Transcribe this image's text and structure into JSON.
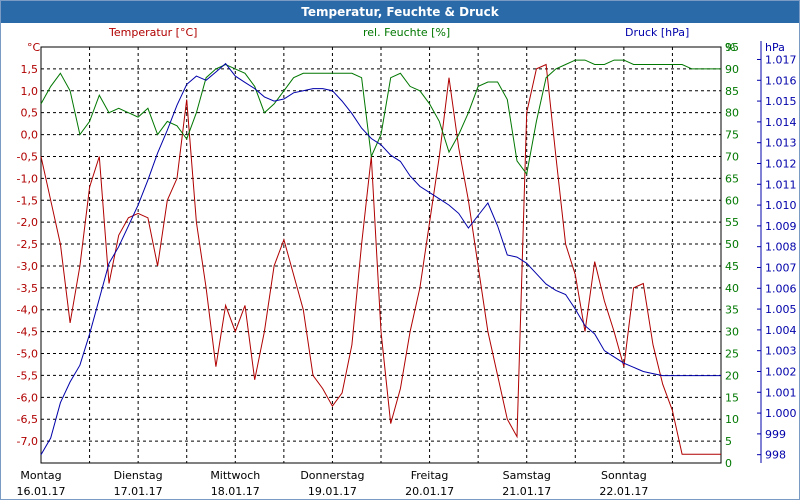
{
  "title": "Temperatur, Feuchte & Druck",
  "headers": {
    "temp": "Temperatur [°C]",
    "hum": "rel. Feuchte [%]",
    "press": "Druck [hPa]"
  },
  "colors": {
    "temp": "#b00000",
    "hum": "#007700",
    "press": "#0000aa",
    "grid": "#000000",
    "title_bg": "#2a6aa8"
  },
  "chart_data": {
    "type": "line",
    "title": "Temperatur, Feuchte & Druck",
    "grid": true,
    "x_days": [
      {
        "day": "Montag",
        "date": "16.01.17"
      },
      {
        "day": "Dienstag",
        "date": "17.01.17"
      },
      {
        "day": "Mittwoch",
        "date": "18.01.17"
      },
      {
        "day": "Donnerstag",
        "date": "19.01.17"
      },
      {
        "day": "Freitag",
        "date": "20.01.17"
      },
      {
        "day": "Samstag",
        "date": "21.01.17"
      },
      {
        "day": "Sonntag",
        "date": "22.01.17"
      }
    ],
    "axes": {
      "temp": {
        "unit": "°C",
        "ylim": [
          -7.5,
          2.0
        ],
        "ticks": [
          "1,5",
          "1,0",
          "0,5",
          "0,0",
          "-0,5",
          "-1,0",
          "-1,5",
          "-2,0",
          "-2,5",
          "-3,0",
          "-3,5",
          "-4,0",
          "-4,5",
          "-5,0",
          "-5,5",
          "-6,0",
          "-6,5",
          "-7,0"
        ],
        "tick_values": [
          1.5,
          1.0,
          0.5,
          0.0,
          -0.5,
          -1.0,
          -1.5,
          -2.0,
          -2.5,
          -3.0,
          -3.5,
          -4.0,
          -4.5,
          -5.0,
          -5.5,
          -6.0,
          -6.5,
          -7.0
        ]
      },
      "hum": {
        "unit": "%",
        "ylim": [
          0,
          95
        ],
        "ticks": [
          "95",
          "90",
          "85",
          "80",
          "75",
          "70",
          "65",
          "60",
          "55",
          "50",
          "45",
          "40",
          "35",
          "30",
          "25",
          "20",
          "15",
          "10",
          "5",
          "0"
        ],
        "tick_values": [
          95,
          90,
          85,
          80,
          75,
          70,
          65,
          60,
          55,
          50,
          45,
          40,
          35,
          30,
          25,
          20,
          15,
          10,
          5,
          0
        ]
      },
      "press": {
        "unit": "hPa",
        "ylim": [
          997.6,
          1017.6
        ],
        "ticks": [
          "1.017",
          "1.016",
          "1.015",
          "1.014",
          "1.013",
          "1.012",
          "1.011",
          "1.010",
          "1.009",
          "1.008",
          "1.007",
          "1.006",
          "1.005",
          "1.004",
          "1.003",
          "1.002",
          "1.001",
          "1.000",
          "999",
          "998"
        ],
        "tick_values": [
          1017,
          1016,
          1015,
          1014,
          1013,
          1012,
          1011,
          1010,
          1009,
          1008,
          1007,
          1006,
          1005,
          1004,
          1003,
          1002,
          1001,
          1000,
          999,
          998
        ]
      }
    },
    "series": [
      {
        "name": "Temperatur [°C]",
        "axis": "temp",
        "x": [
          0,
          0.1,
          0.2,
          0.3,
          0.4,
          0.5,
          0.6,
          0.7,
          0.8,
          0.9,
          1.0,
          1.1,
          1.2,
          1.3,
          1.4,
          1.5,
          1.6,
          1.7,
          1.8,
          1.9,
          2.0,
          2.1,
          2.2,
          2.3,
          2.4,
          2.5,
          2.6,
          2.7,
          2.8,
          2.9,
          3.0,
          3.1,
          3.2,
          3.3,
          3.4,
          3.5,
          3.6,
          3.7,
          3.8,
          3.9,
          4.0,
          4.1,
          4.2,
          4.3,
          4.4,
          4.5,
          4.6,
          4.7,
          4.8,
          4.9,
          5.0,
          5.1,
          5.2,
          5.3,
          5.4,
          5.5,
          5.6,
          5.7,
          5.8,
          5.9,
          6.0,
          6.1,
          6.2,
          6.3,
          6.4,
          6.5,
          6.6,
          6.7,
          6.8,
          6.9,
          7.0
        ],
        "values": [
          -0.5,
          -1.5,
          -2.5,
          -4.3,
          -3.0,
          -1.2,
          -0.5,
          -3.4,
          -2.3,
          -1.9,
          -1.8,
          -1.9,
          -3.0,
          -1.5,
          -1.0,
          0.8,
          -2.0,
          -3.5,
          -5.3,
          -3.9,
          -4.5,
          -3.9,
          -5.6,
          -4.5,
          -3.0,
          -2.4,
          -3.2,
          -4.0,
          -5.5,
          -5.8,
          -6.2,
          -5.9,
          -4.8,
          -2.5,
          -0.5,
          -4.5,
          -6.6,
          -5.8,
          -4.5,
          -3.5,
          -2.0,
          -0.5,
          1.3,
          -0.3,
          -1.5,
          -3.0,
          -4.5,
          -5.5,
          -6.5,
          -6.9,
          0.5,
          1.5,
          1.6,
          -0.5,
          -2.5,
          -3.2,
          -4.5,
          -2.9,
          -3.8,
          -4.5,
          -5.3,
          -3.5,
          -3.4,
          -4.8,
          -5.7,
          -6.3,
          -7.3,
          -7.3,
          -7.3,
          -7.3,
          -7.3
        ]
      },
      {
        "name": "rel. Feuchte [%]",
        "axis": "hum",
        "x": [
          0,
          0.1,
          0.2,
          0.3,
          0.4,
          0.5,
          0.6,
          0.7,
          0.8,
          0.9,
          1.0,
          1.1,
          1.2,
          1.3,
          1.4,
          1.5,
          1.6,
          1.7,
          1.8,
          1.9,
          2.0,
          2.1,
          2.2,
          2.3,
          2.4,
          2.5,
          2.6,
          2.7,
          2.8,
          2.9,
          3.0,
          3.1,
          3.2,
          3.3,
          3.4,
          3.5,
          3.6,
          3.7,
          3.8,
          3.9,
          4.0,
          4.1,
          4.2,
          4.3,
          4.4,
          4.5,
          4.6,
          4.7,
          4.8,
          4.9,
          5.0,
          5.1,
          5.2,
          5.3,
          5.4,
          5.5,
          5.6,
          5.7,
          5.8,
          5.9,
          6.0,
          6.1,
          6.2,
          6.3,
          6.4,
          6.5,
          6.6,
          6.7,
          6.8,
          6.9,
          7.0
        ],
        "values": [
          82,
          86,
          89,
          85,
          75,
          78,
          84,
          80,
          81,
          80,
          79,
          81,
          75,
          78,
          77,
          74,
          80,
          88,
          90,
          91,
          90,
          89,
          86,
          80,
          82,
          85,
          88,
          89,
          89,
          89,
          89,
          89,
          89,
          88,
          70,
          75,
          88,
          89,
          86,
          85,
          82,
          78,
          71,
          75,
          80,
          86,
          87,
          87,
          83,
          69,
          66,
          78,
          88,
          90,
          91,
          92,
          92,
          91,
          91,
          92,
          92,
          91,
          91,
          91,
          91,
          91,
          91,
          90,
          90,
          90,
          90
        ]
      },
      {
        "name": "Druck [hPa]",
        "axis": "press",
        "x": [
          0,
          0.1,
          0.2,
          0.3,
          0.4,
          0.5,
          0.6,
          0.7,
          0.8,
          0.9,
          1.0,
          1.1,
          1.2,
          1.3,
          1.4,
          1.5,
          1.6,
          1.7,
          1.8,
          1.9,
          2.0,
          2.1,
          2.2,
          2.3,
          2.4,
          2.5,
          2.6,
          2.7,
          2.8,
          2.9,
          3.0,
          3.1,
          3.2,
          3.3,
          3.4,
          3.5,
          3.6,
          3.7,
          3.8,
          3.9,
          4.0,
          4.1,
          4.2,
          4.3,
          4.4,
          4.5,
          4.6,
          4.7,
          4.8,
          4.9,
          5.0,
          5.1,
          5.2,
          5.3,
          5.4,
          5.5,
          5.6,
          5.7,
          5.8,
          5.9,
          6.0,
          6.1,
          6.2,
          6.3,
          6.4,
          6.5,
          6.6,
          6.7,
          6.8,
          6.9,
          7.0
        ],
        "values": [
          998.0,
          998.8,
          1000.5,
          1001.5,
          1002.3,
          1003.8,
          1005.5,
          1007.2,
          1008.0,
          1009.0,
          1010.0,
          1011.2,
          1012.5,
          1013.6,
          1014.8,
          1015.8,
          1016.2,
          1016.0,
          1016.4,
          1016.8,
          1016.2,
          1015.9,
          1015.6,
          1015.2,
          1015.0,
          1015.1,
          1015.4,
          1015.5,
          1015.6,
          1015.6,
          1015.5,
          1015.0,
          1014.4,
          1013.7,
          1013.2,
          1012.9,
          1012.4,
          1012.1,
          1011.4,
          1010.9,
          1010.6,
          1010.3,
          1010.0,
          1009.6,
          1008.9,
          1009.5,
          1010.1,
          1009.0,
          1007.6,
          1007.5,
          1007.2,
          1006.7,
          1006.2,
          1005.9,
          1005.7,
          1005.0,
          1004.2,
          1003.8,
          1003.0,
          1002.7,
          1002.4,
          1002.2,
          1002.0,
          1001.9,
          1001.8,
          1001.8,
          1001.8,
          1001.8,
          1001.8,
          1001.8,
          1001.8
        ]
      }
    ]
  }
}
